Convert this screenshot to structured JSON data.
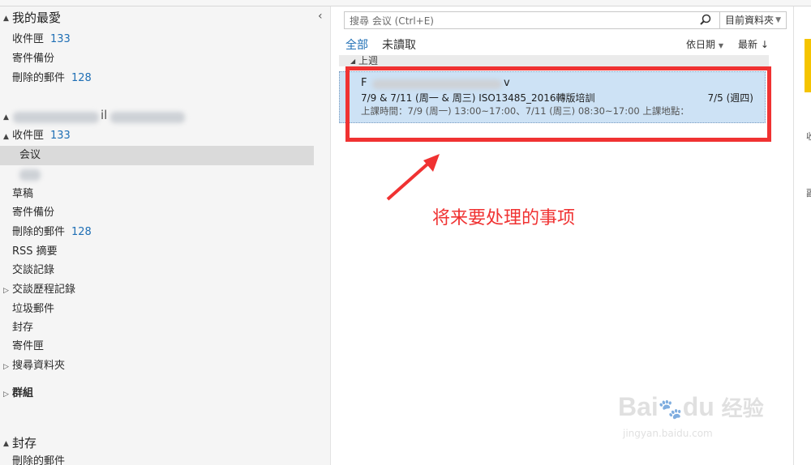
{
  "folder_pane": {
    "favorites_header": "我的最愛",
    "favorites": [
      {
        "label": "收件匣",
        "count": "133"
      },
      {
        "label": "寄件備份",
        "count": ""
      },
      {
        "label": "刪除的郵件",
        "count": "128"
      }
    ],
    "account_folders": [
      {
        "label": "收件匣",
        "count": "133",
        "expand": "▲"
      },
      {
        "label": "会议",
        "count": "",
        "selected": true
      },
      {
        "label": "草稿",
        "count": ""
      },
      {
        "label": "寄件備份",
        "count": ""
      },
      {
        "label": "刪除的郵件",
        "count": "128"
      },
      {
        "label": "RSS 摘要",
        "count": ""
      },
      {
        "label": "交談記錄",
        "count": ""
      },
      {
        "label": "交談歷程記錄",
        "count": "",
        "expand": "▷"
      },
      {
        "label": "垃圾郵件",
        "count": ""
      },
      {
        "label": "封存",
        "count": ""
      },
      {
        "label": "寄件匣",
        "count": ""
      },
      {
        "label": "搜尋資料夾",
        "count": "",
        "expand": "▷"
      }
    ],
    "groups_header": "群組",
    "archive_header": "封存",
    "archive_first_item": "刪除的郵件",
    "collapse_glyph": "‹"
  },
  "search": {
    "placeholder": "搜尋 会议 (Ctrl+E)",
    "scope": "目前資料夾"
  },
  "filters": {
    "all": "全部",
    "unread": "未讀取"
  },
  "sort": {
    "by": "依日期",
    "order": "最新"
  },
  "group_label": "上週",
  "message": {
    "from": "F",
    "from_tail": "v",
    "subject": "7/9 & 7/11 (周一 & 周三) ISO13485_2016轉版培訓",
    "date": "7/5 (週四)",
    "preview": "上課時間：7/9 (周一) 13:00~17:00、7/11 (周三) 08:30~17:00 上課地點："
  },
  "annotation": "将来要处理的事项",
  "watermark": {
    "brand": "Bai",
    "brand_tail": "du",
    "brand_cn": "经验",
    "url": "jingyan.baidu.com"
  },
  "right_pane": {
    "char1": "收",
    "char2": "副"
  },
  "colors": {
    "accent": "#1f6fb5",
    "annotation_red": "#f03232",
    "selection_blue": "#cde2f5"
  }
}
